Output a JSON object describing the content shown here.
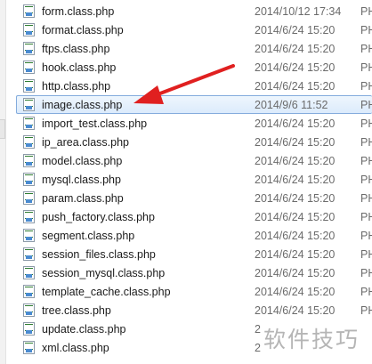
{
  "files": [
    {
      "name": "form.class.php",
      "date": "2014/10/12 17:34",
      "type": "PH",
      "selected": false
    },
    {
      "name": "format.class.php",
      "date": "2014/6/24 15:20",
      "type": "PH",
      "selected": false
    },
    {
      "name": "ftps.class.php",
      "date": "2014/6/24 15:20",
      "type": "PH",
      "selected": false
    },
    {
      "name": "hook.class.php",
      "date": "2014/6/24 15:20",
      "type": "PH",
      "selected": false
    },
    {
      "name": "http.class.php",
      "date": "2014/6/24 15:20",
      "type": "PH",
      "selected": false
    },
    {
      "name": "image.class.php",
      "date": "2014/9/6 11:52",
      "type": "PH",
      "selected": true
    },
    {
      "name": "import_test.class.php",
      "date": "2014/6/24 15:20",
      "type": "PH",
      "selected": false
    },
    {
      "name": "ip_area.class.php",
      "date": "2014/6/24 15:20",
      "type": "PH",
      "selected": false
    },
    {
      "name": "model.class.php",
      "date": "2014/6/24 15:20",
      "type": "PH",
      "selected": false
    },
    {
      "name": "mysql.class.php",
      "date": "2014/6/24 15:20",
      "type": "PH",
      "selected": false
    },
    {
      "name": "param.class.php",
      "date": "2014/6/24 15:20",
      "type": "PH",
      "selected": false
    },
    {
      "name": "push_factory.class.php",
      "date": "2014/6/24 15:20",
      "type": "PH",
      "selected": false
    },
    {
      "name": "segment.class.php",
      "date": "2014/6/24 15:20",
      "type": "PH",
      "selected": false
    },
    {
      "name": "session_files.class.php",
      "date": "2014/6/24 15:20",
      "type": "PH",
      "selected": false
    },
    {
      "name": "session_mysql.class.php",
      "date": "2014/6/24 15:20",
      "type": "PH",
      "selected": false
    },
    {
      "name": "template_cache.class.php",
      "date": "2014/6/24 15:20",
      "type": "PH",
      "selected": false
    },
    {
      "name": "tree.class.php",
      "date": "2014/6/24 15:20",
      "type": "PH",
      "selected": false
    },
    {
      "name": "update.class.php",
      "date": "2",
      "type": "",
      "selected": false
    },
    {
      "name": "xml.class.php",
      "date": "2",
      "type": "",
      "selected": false
    }
  ],
  "watermark": "软件技巧",
  "colors": {
    "selection_border": "#84acdd",
    "selection_fill": "#dcebfc",
    "arrow": "#e02020"
  }
}
